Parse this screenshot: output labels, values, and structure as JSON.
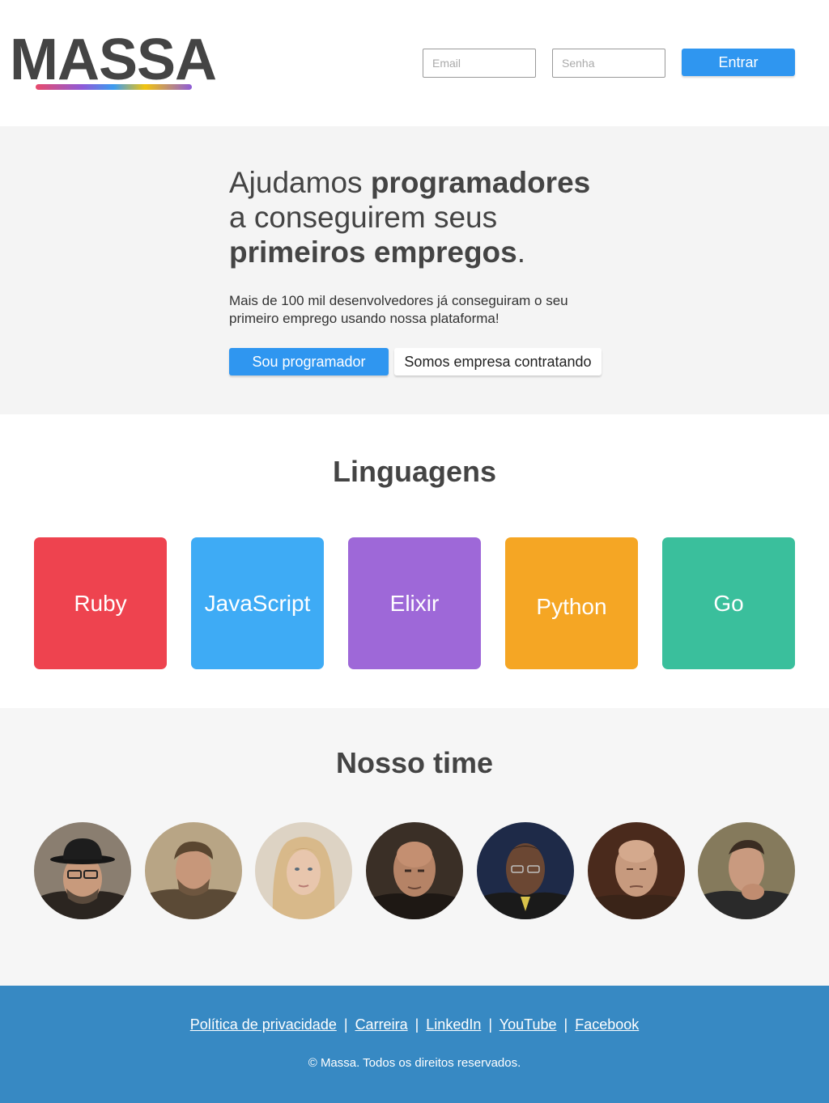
{
  "header": {
    "logo": "MASSA",
    "email_placeholder": "Email",
    "senha_placeholder": "Senha",
    "login_button": "Entrar"
  },
  "hero": {
    "title_part1": "Ajudamos ",
    "title_bold1": "programadores",
    "title_part2": "a conseguirem seus",
    "title_bold2": "primeiros empregos",
    "title_end": ".",
    "subtitle": "Mais de 100 mil desenvolvedores já conseguiram o seu primeiro emprego usando nossa plataforma!",
    "button_programmer": "Sou programador",
    "button_company": "Somos empresa contratando"
  },
  "languages": {
    "title": "Linguagens",
    "items": [
      {
        "label": "Ruby",
        "color": "#ee434f"
      },
      {
        "label": "JavaScript",
        "color": "#3eabf5"
      },
      {
        "label": "Elixir",
        "color": "#9e68d8"
      },
      {
        "label": "Python",
        "color": "#f5a624"
      },
      {
        "label": "Go",
        "color": "#3abf9c"
      }
    ]
  },
  "team": {
    "title": "Nosso time",
    "member_count": 7
  },
  "footer": {
    "links": [
      "Política de privacidade",
      "Carreira",
      "LinkedIn",
      "YouTube",
      "Facebook"
    ],
    "separator": "|",
    "copyright": "© Massa. Todos os direitos reservados."
  },
  "colors": {
    "primary": "#2f96f0",
    "footer_bg": "#3789c3",
    "text": "#444444"
  }
}
